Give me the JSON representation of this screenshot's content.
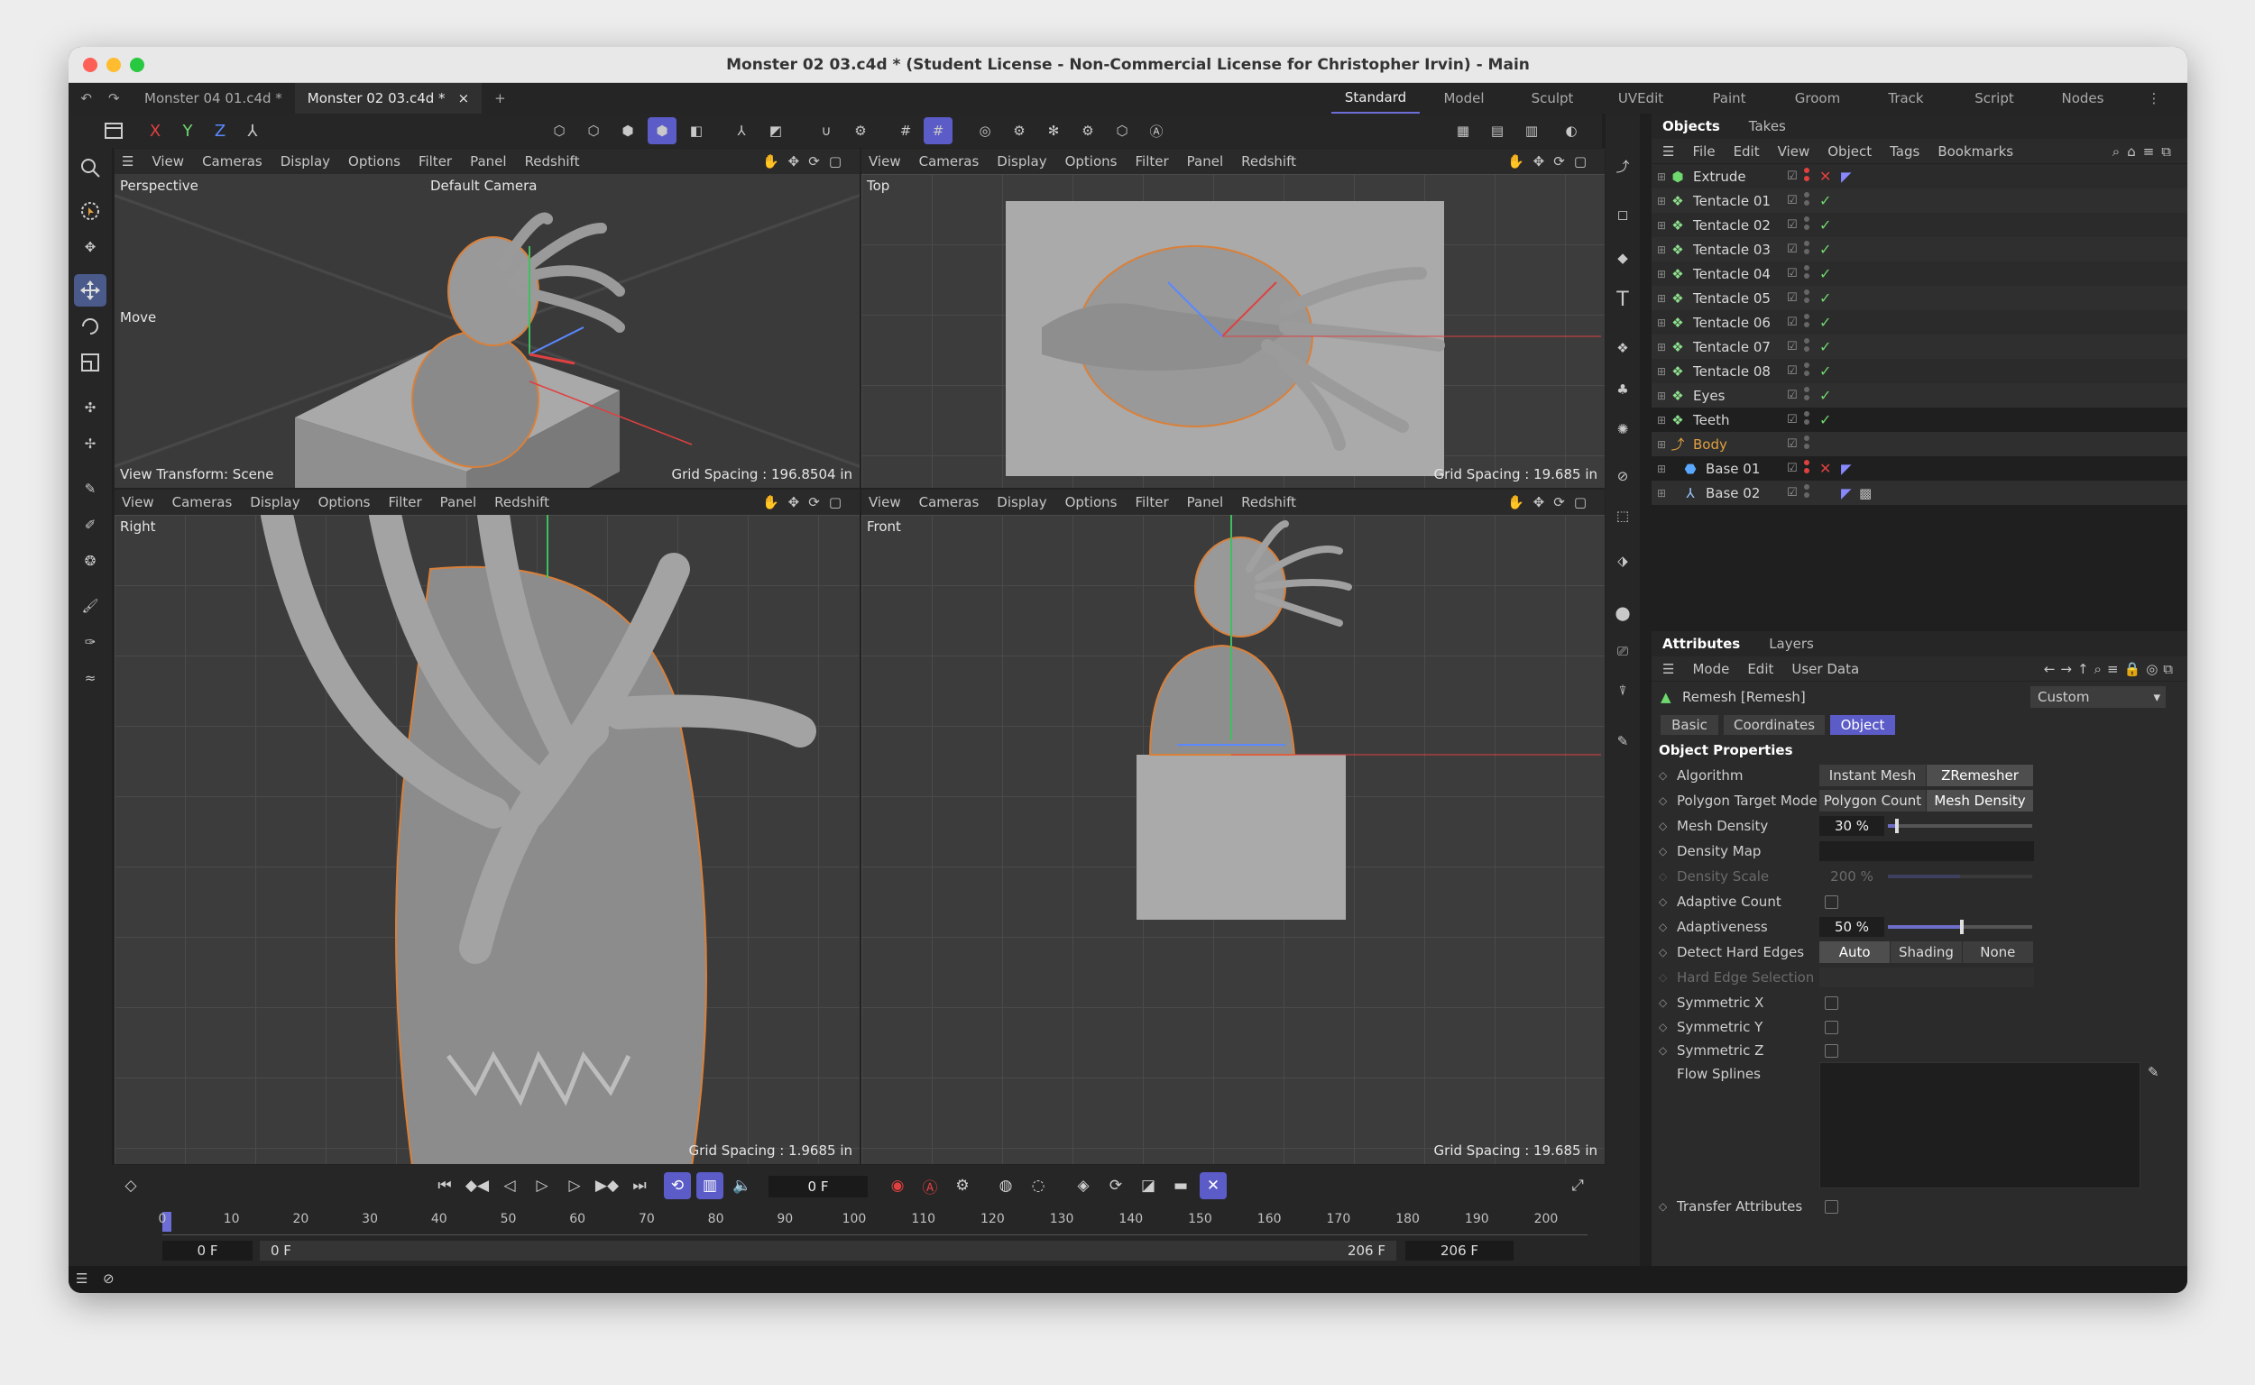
{
  "window": {
    "title": "Monster 02 03.c4d * (Student License - Non-Commercial License for Christopher Irvin) - Main"
  },
  "doc_tabs": [
    {
      "label": "Monster 04 01.c4d *",
      "active": false
    },
    {
      "label": "Monster 02 03.c4d *",
      "active": true
    }
  ],
  "doc_tab_close": "×",
  "doc_tab_add": "+",
  "layouts": [
    "Standard",
    "Model",
    "Sculpt",
    "UVEdit",
    "Paint",
    "Groom",
    "Track",
    "Script",
    "Nodes"
  ],
  "layouts_active": "Standard",
  "axes": {
    "x": "X",
    "y": "Y",
    "z": "Z"
  },
  "viewport_menu": [
    "View",
    "Cameras",
    "Display",
    "Options",
    "Filter",
    "Panel",
    "Redshift"
  ],
  "viewports": {
    "perspective": {
      "name": "Perspective",
      "camera": "Default Camera",
      "tool": "Move",
      "transform": "View Transform: Scene",
      "grid": "Grid Spacing : 196.8504 in"
    },
    "top": {
      "name": "Top",
      "grid": "Grid Spacing : 19.685 in"
    },
    "right": {
      "name": "Right",
      "grid": "Grid Spacing : 1.9685 in"
    },
    "front": {
      "name": "Front",
      "grid": "Grid Spacing : 19.685 in"
    }
  },
  "objects_panel": {
    "tabs": [
      "Objects",
      "Takes"
    ],
    "menu": [
      "File",
      "Edit",
      "View",
      "Object",
      "Tags",
      "Bookmarks"
    ],
    "items": [
      {
        "name": "Extrude",
        "icon": "extrude-icon",
        "status": "off",
        "indent": 0
      },
      {
        "name": "Tentacle 01",
        "icon": "generator-icon",
        "status": "on",
        "indent": 0
      },
      {
        "name": "Tentacle 02",
        "icon": "generator-icon",
        "status": "on",
        "indent": 0
      },
      {
        "name": "Tentacle 03",
        "icon": "generator-icon",
        "status": "on",
        "indent": 0
      },
      {
        "name": "Tentacle 04",
        "icon": "generator-icon",
        "status": "on",
        "indent": 0
      },
      {
        "name": "Tentacle 05",
        "icon": "generator-icon",
        "status": "on",
        "indent": 0
      },
      {
        "name": "Tentacle 06",
        "icon": "generator-icon",
        "status": "on",
        "indent": 0
      },
      {
        "name": "Tentacle 07",
        "icon": "generator-icon",
        "status": "on",
        "indent": 0
      },
      {
        "name": "Tentacle 08",
        "icon": "generator-icon",
        "status": "on",
        "indent": 0
      },
      {
        "name": "Eyes",
        "icon": "generator-icon",
        "status": "on",
        "indent": 0
      },
      {
        "name": "Teeth",
        "icon": "generator-icon",
        "status": "on",
        "indent": 0
      },
      {
        "name": "Body",
        "icon": "null-icon",
        "status": "none",
        "indent": 0
      },
      {
        "name": "Base 01",
        "icon": "cube-icon",
        "status": "off",
        "indent": 1
      },
      {
        "name": "Base 02",
        "icon": "camera-target-icon",
        "status": "none",
        "indent": 1
      }
    ]
  },
  "attributes_panel": {
    "tabs": [
      "Attributes",
      "Layers"
    ],
    "menu": [
      "Mode",
      "Edit",
      "User Data"
    ],
    "object_title": "Remesh [Remesh]",
    "preset": "Custom",
    "subtabs": [
      "Basic",
      "Coordinates",
      "Object"
    ],
    "subtabs_active": "Object",
    "section": "Object Properties",
    "algorithm": {
      "label": "Algorithm",
      "options": [
        "Instant Mesh",
        "ZRemesher"
      ],
      "selected": "ZRemesher"
    },
    "polygon_target_mode": {
      "label": "Polygon Target Mode",
      "options": [
        "Polygon Count",
        "Mesh Density"
      ],
      "selected": "Mesh Density"
    },
    "mesh_density": {
      "label": "Mesh Density",
      "value": "30 %",
      "fraction": 0.05
    },
    "density_map": {
      "label": "Density Map"
    },
    "density_scale": {
      "label": "Density Scale",
      "value": "200 %"
    },
    "adaptive_count": {
      "label": "Adaptive Count"
    },
    "adaptiveness": {
      "label": "Adaptiveness",
      "value": "50 %",
      "fraction": 0.5
    },
    "detect_hard_edges": {
      "label": "Detect Hard Edges",
      "options": [
        "Auto",
        "Shading",
        "None"
      ],
      "selected": "Auto"
    },
    "hard_edge_selection": {
      "label": "Hard Edge Selection"
    },
    "symmetric_x": {
      "label": "Symmetric X"
    },
    "symmetric_y": {
      "label": "Symmetric Y"
    },
    "symmetric_z": {
      "label": "Symmetric Z"
    },
    "flow_splines": {
      "label": "Flow Splines"
    },
    "transfer_attributes": {
      "label": "Transfer Attributes"
    }
  },
  "timeline": {
    "current_frame": "0 F",
    "start_frame": "0 F",
    "min_frame": "0 F",
    "max_frame": "206 F",
    "end_frame": "206 F",
    "ticks": [
      "0",
      "10",
      "20",
      "30",
      "40",
      "50",
      "60",
      "70",
      "80",
      "90",
      "100",
      "110",
      "120",
      "130",
      "140",
      "150",
      "160",
      "170",
      "180",
      "190",
      "200"
    ]
  },
  "colors": {
    "accent": "#5c5cc9",
    "axis_x": "#e04040",
    "axis_y": "#6fd86f",
    "axis_z": "#5a88ff",
    "selection_outline": "#d9803a"
  }
}
